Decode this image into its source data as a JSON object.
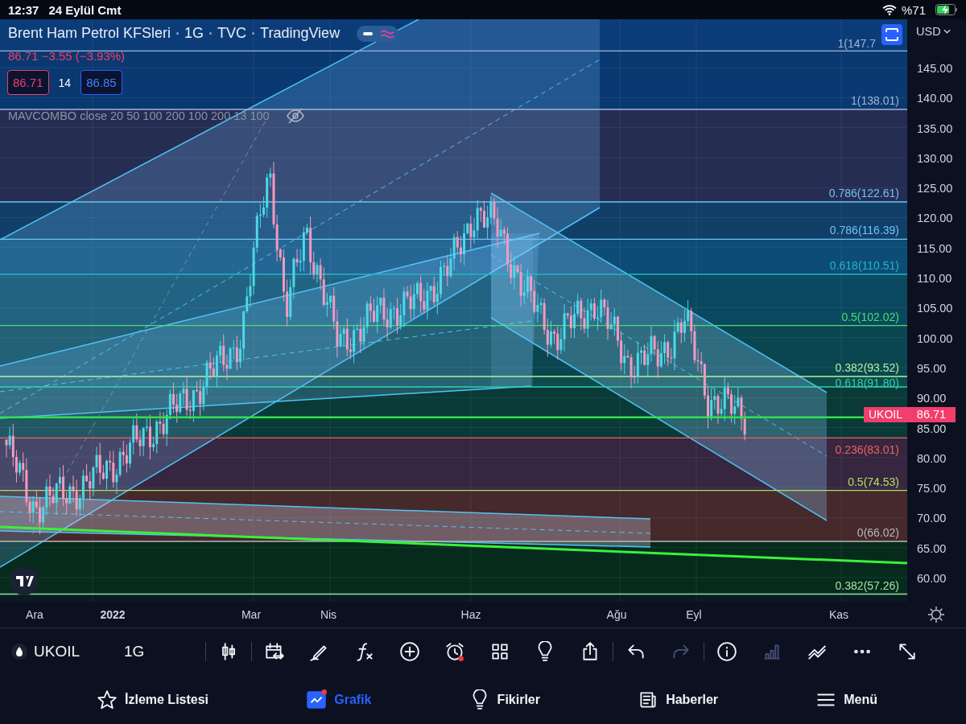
{
  "status_bar": {
    "time": "12:37",
    "date": "24 Eylül Cmt",
    "battery": "%71",
    "charging": true
  },
  "chart": {
    "title_parts": [
      "Brent Ham Petrol KFSleri",
      "1G",
      "TVC",
      "TradingView"
    ],
    "change": "86.71 −3.55 (−3.93%)",
    "bid": "86.71",
    "spread": "14",
    "ask": "86.85",
    "indicator": "MAVCOMBO close 20 50 100 200 100 200 13 100",
    "indicator_visible": false,
    "fib_levels": [
      {
        "label": "1(147.7",
        "color": "#9fb6d6"
      },
      {
        "label": "1(138.01)",
        "color": "#9fb6d6"
      },
      {
        "label": "0.786(122.61)",
        "color": "#6ec3f5"
      },
      {
        "label": "0.786(116.39)",
        "color": "#6ec3f5"
      },
      {
        "label": "0.618(110.51)",
        "color": "#1fb8c8"
      },
      {
        "label": "0.5(102.02)",
        "color": "#4ade6a"
      },
      {
        "label": "0.382(93.52)",
        "color": "#b5f0a0"
      },
      {
        "label": "0.618(91.80)",
        "color": "#30d0b0"
      },
      {
        "label": "0.236(83.01)",
        "color": "#f06060"
      },
      {
        "label": "0.5(74.53)",
        "color": "#b0e060"
      },
      {
        "label": "0(66.02)",
        "color": "#b8b8b8"
      },
      {
        "label": "0.382(57.26)",
        "color": "#a0e0a0"
      }
    ],
    "symbol_tag": "UKOIL"
  },
  "price_axis": {
    "currency": "USD",
    "ticks": [
      "145.00",
      "140.00",
      "135.00",
      "130.00",
      "125.00",
      "120.00",
      "115.00",
      "110.00",
      "105.00",
      "100.00",
      "95.00",
      "90.00",
      "85.00",
      "80.00",
      "75.00",
      "70.00",
      "65.00",
      "60.00"
    ],
    "current": "86.71"
  },
  "time_axis": [
    {
      "label": "Ara",
      "kind": "month"
    },
    {
      "label": "2022",
      "kind": "year"
    },
    {
      "label": "Mar",
      "kind": "month"
    },
    {
      "label": "Nis",
      "kind": "month"
    },
    {
      "label": "Haz",
      "kind": "month"
    },
    {
      "label": "Ağu",
      "kind": "month"
    },
    {
      "label": "Eyl",
      "kind": "month"
    },
    {
      "label": "Kas",
      "kind": "month"
    }
  ],
  "toolbar": {
    "symbol": "UKOIL",
    "interval": "1G",
    "tool_groups": [
      [
        {
          "kind": "candles",
          "disabled": false,
          "alert": false
        }
      ],
      [
        {
          "kind": "calendar",
          "disabled": false,
          "alert": false
        },
        {
          "kind": "pen",
          "disabled": false,
          "alert": false
        },
        {
          "kind": "fx",
          "disabled": false,
          "alert": false
        },
        {
          "kind": "add",
          "disabled": false,
          "alert": false
        },
        {
          "kind": "alarm",
          "disabled": false,
          "alert": true
        },
        {
          "kind": "grid",
          "disabled": false,
          "alert": false
        },
        {
          "kind": "bulb",
          "disabled": false,
          "alert": false
        },
        {
          "kind": "share",
          "disabled": false,
          "alert": false
        }
      ],
      [
        {
          "kind": "undo",
          "disabled": false,
          "alert": false
        },
        {
          "kind": "redo",
          "disabled": true,
          "alert": false
        }
      ],
      [
        {
          "kind": "info",
          "disabled": false,
          "alert": false
        },
        {
          "kind": "bars",
          "disabled": true,
          "alert": false
        },
        {
          "kind": "wave",
          "disabled": false,
          "alert": false
        },
        {
          "kind": "more",
          "disabled": false,
          "alert": false
        },
        {
          "kind": "expand",
          "disabled": false,
          "alert": false
        }
      ]
    ]
  },
  "nav": [
    {
      "label": "İzleme Listesi",
      "kind": "star",
      "selected": false,
      "badge": false
    },
    {
      "label": "Grafik",
      "kind": "chart",
      "selected": true,
      "badge": true
    },
    {
      "label": "Fikirler",
      "kind": "bulb",
      "selected": false,
      "badge": false
    },
    {
      "label": "Haberler",
      "kind": "news",
      "selected": false,
      "badge": false
    },
    {
      "label": "Menü",
      "kind": "menu",
      "selected": false,
      "badge": false
    }
  ]
}
